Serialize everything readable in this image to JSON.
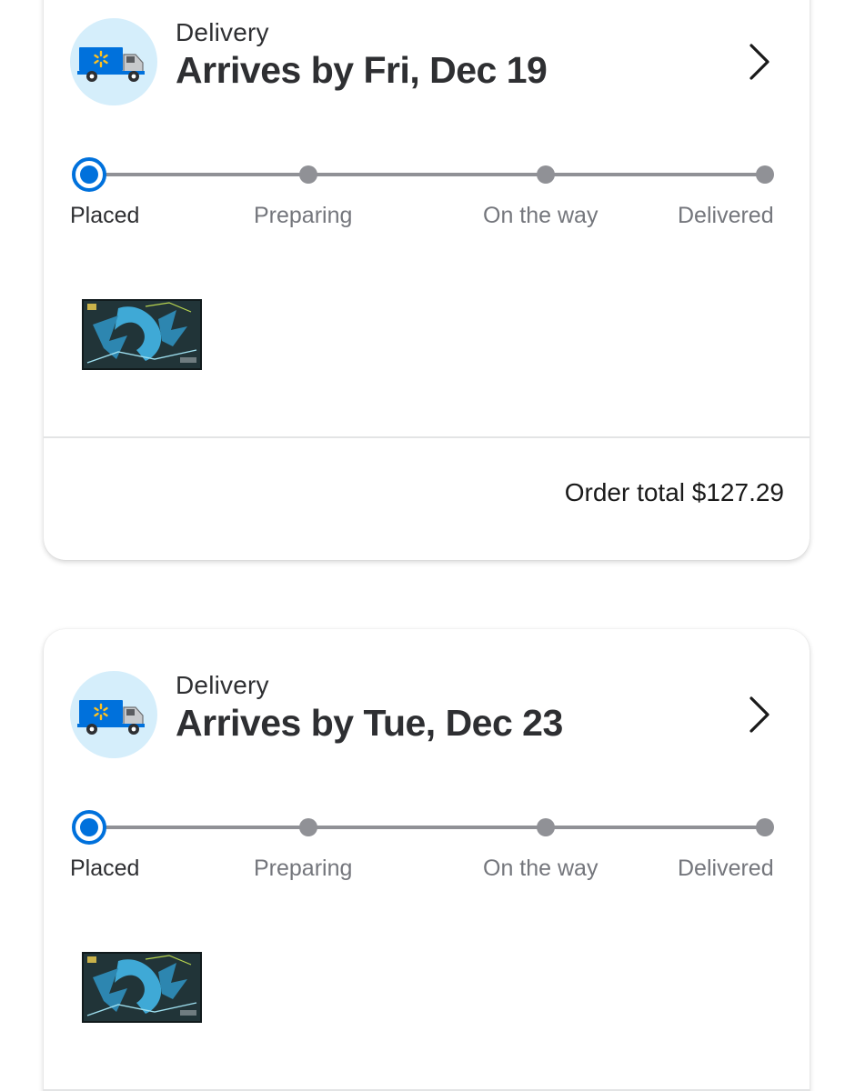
{
  "orders": [
    {
      "method": "Delivery",
      "arrives": "Arrives by Fri, Dec 19",
      "steps": [
        "Placed",
        "Preparing",
        "On the way",
        "Delivered"
      ],
      "current_step": "Placed",
      "total": "Order total $127.29"
    },
    {
      "method": "Delivery",
      "arrives": "Arrives by Tue, Dec 23",
      "steps": [
        "Placed",
        "Preparing",
        "On the way",
        "Delivered"
      ],
      "current_step": "Placed"
    }
  ],
  "icons": {
    "delivery": "delivery-truck-icon",
    "open": "chevron-right-icon",
    "product": "product-image"
  },
  "colors": {
    "accent": "#0071dc",
    "inactive": "#909196",
    "icon_bg": "#d5eefb",
    "spark": "#ffc220"
  }
}
